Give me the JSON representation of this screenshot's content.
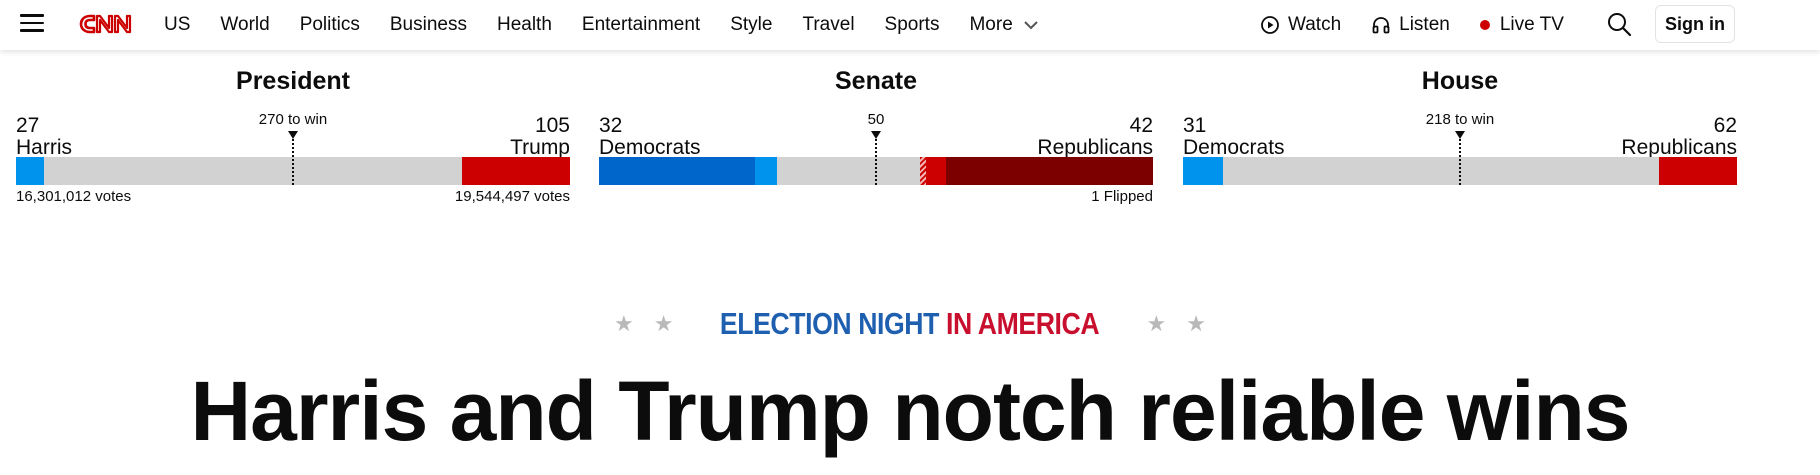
{
  "colors": {
    "dem_light": "#0093ee",
    "dem_dark": "#0066cc",
    "rep": "#cc0000",
    "rep_dark": "#7d0000",
    "neutral_bar": "#d2d2d2",
    "eyebrow_blue": "#1f5fb0",
    "eyebrow_red": "#c8102e"
  },
  "nav": {
    "logo": "CNN",
    "links": [
      "US",
      "World",
      "Politics",
      "Business",
      "Health",
      "Entertainment",
      "Style",
      "Travel",
      "Sports",
      "More"
    ],
    "watch": "Watch",
    "listen": "Listen",
    "live_tv": "Live TV",
    "sign_in": "Sign in"
  },
  "races": {
    "president": {
      "title": "President",
      "threshold": "270 to win",
      "left_count": "27",
      "left_name": "Harris",
      "right_count": "105",
      "right_name": "Trump",
      "left_votes": "16,301,012 votes",
      "right_votes": "19,544,497 votes"
    },
    "senate": {
      "title": "Senate",
      "threshold": "50",
      "left_count": "32",
      "left_name": "Democrats",
      "right_count": "42",
      "right_name": "Republicans",
      "note": "1 Flipped"
    },
    "house": {
      "title": "House",
      "threshold": "218 to win",
      "left_count": "31",
      "left_name": "Democrats",
      "right_count": "62",
      "right_name": "Republicans"
    }
  },
  "hero": {
    "eyebrow_blue": "ELECTION NIGHT",
    "eyebrow_red": "IN AMERICA",
    "stars": "★",
    "headline": "Harris and Trump notch reliable wins"
  }
}
